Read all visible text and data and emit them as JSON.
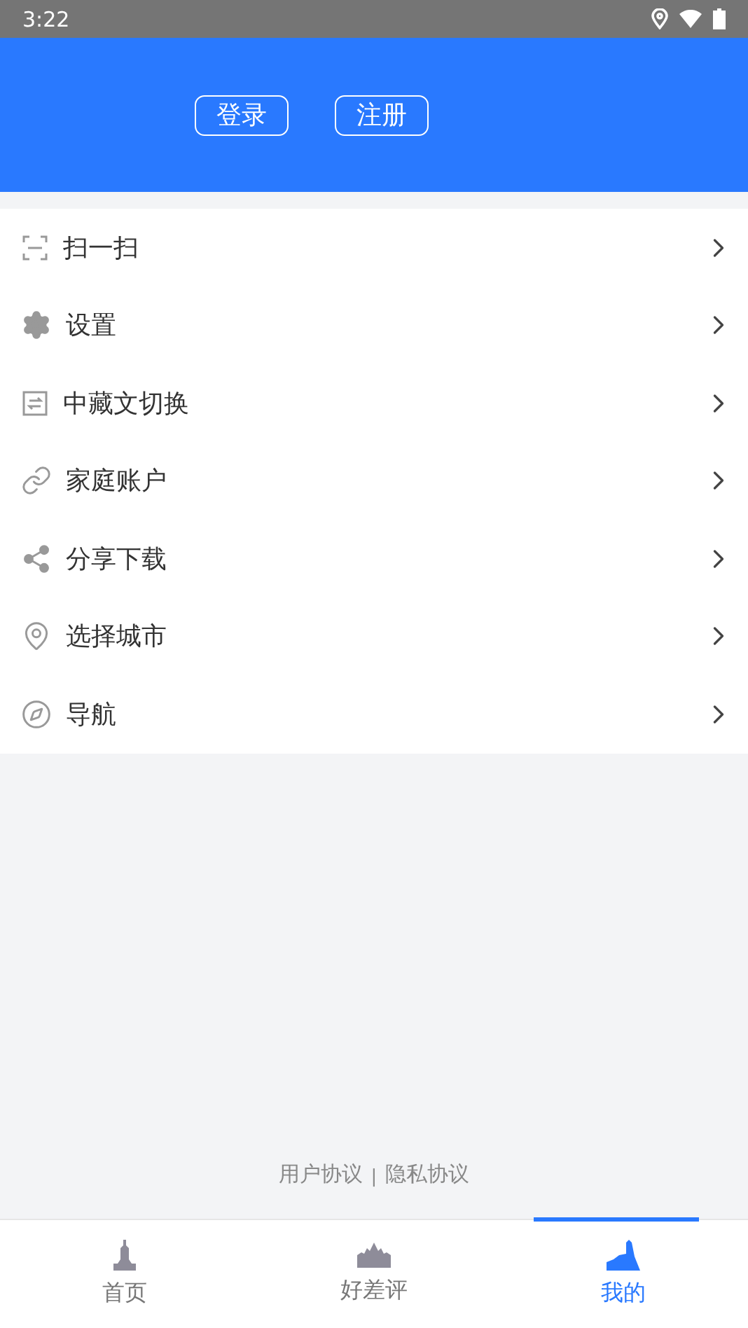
{
  "status_bar": {
    "time": "3:22"
  },
  "header": {
    "buttons": [
      "登录",
      "注册"
    ]
  },
  "menu": [
    {
      "kind": "scan",
      "label": "扫一扫"
    },
    {
      "kind": "settings",
      "label": "设置"
    },
    {
      "kind": "switch",
      "label": "中藏文切换"
    },
    {
      "kind": "link",
      "label": "家庭账户"
    },
    {
      "kind": "share",
      "label": "分享下载"
    },
    {
      "kind": "location",
      "label": "选择城市"
    },
    {
      "kind": "compass",
      "label": "导航"
    }
  ],
  "footer": {
    "links": [
      "用户协议",
      "隐私协议"
    ],
    "separator": "|"
  },
  "tabs": [
    {
      "kind": "pagoda",
      "label": "首页",
      "selected": false
    },
    {
      "kind": "temple",
      "label": "好差评",
      "selected": false
    },
    {
      "kind": "mountain",
      "label": "我的",
      "selected": true
    }
  ]
}
